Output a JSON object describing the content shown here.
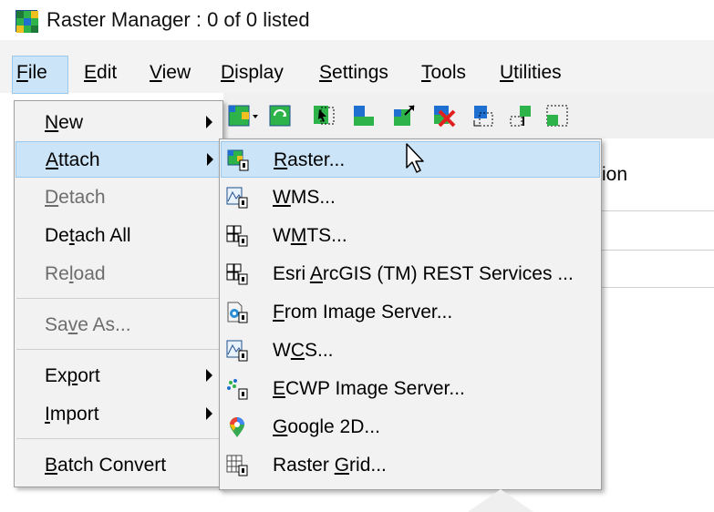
{
  "window": {
    "title": "Raster Manager : 0 of 0 listed"
  },
  "menubar": {
    "items": [
      {
        "label": "File",
        "key": "F",
        "rest": "ile"
      },
      {
        "label": "Edit",
        "key": "E",
        "rest": "dit"
      },
      {
        "label": "View",
        "key": "V",
        "rest": "iew"
      },
      {
        "label": "Display",
        "key": "D",
        "rest": "isplay"
      },
      {
        "label": "Settings",
        "key": "S",
        "rest": "ettings"
      },
      {
        "label": "Tools",
        "key": "T",
        "rest": "ools"
      },
      {
        "label": "Utilities",
        "key": "U",
        "rest": "tilities"
      }
    ]
  },
  "file_menu": {
    "items": [
      {
        "pre": "",
        "key": "N",
        "post": "ew",
        "full": "New",
        "enabled": true,
        "submenu": true
      },
      {
        "pre": "",
        "key": "A",
        "post": "ttach",
        "full": "Attach",
        "enabled": true,
        "submenu": true,
        "highlighted": true
      },
      {
        "pre": "",
        "key": "D",
        "post": "etach",
        "full": "Detach",
        "enabled": false
      },
      {
        "pre": "De",
        "key": "t",
        "post": "ach All",
        "full": "Detach All",
        "enabled": true
      },
      {
        "pre": "Re",
        "key": "l",
        "post": "oad",
        "full": "Reload",
        "enabled": false
      },
      {
        "pre": "Sa",
        "key": "v",
        "post": "e As...",
        "full": "Save As...",
        "enabled": false
      },
      {
        "pre": "Ex",
        "key": "p",
        "post": "ort",
        "full": "Export",
        "enabled": true,
        "submenu": true
      },
      {
        "pre": "",
        "key": "I",
        "post": "mport",
        "full": "Import",
        "enabled": true,
        "submenu": true
      },
      {
        "pre": "",
        "key": "B",
        "post": "atch Convert",
        "full": "Batch Convert",
        "enabled": true
      }
    ]
  },
  "attach_menu": {
    "items": [
      {
        "pre": "",
        "key": "R",
        "post": "aster...",
        "full": "Raster...",
        "icon": "raster-attach-icon",
        "highlighted": true
      },
      {
        "pre": "",
        "key": "W",
        "post": "MS...",
        "full": "WMS...",
        "icon": "wms-icon"
      },
      {
        "pre": "W",
        "key": "M",
        "post": "TS...",
        "full": "WMTS...",
        "icon": "wmts-icon"
      },
      {
        "pre": "Esri ",
        "key": "A",
        "post": "rcGIS (TM) REST Services ...",
        "full": "Esri ArcGIS (TM) REST Services ...",
        "icon": "arcgis-rest-icon"
      },
      {
        "pre": "",
        "key": "F",
        "post": "rom Image Server...",
        "full": "From Image Server...",
        "icon": "image-server-icon"
      },
      {
        "pre": "W",
        "key": "C",
        "post": "S...",
        "full": "WCS...",
        "icon": "wcs-icon"
      },
      {
        "pre": "",
        "key": "E",
        "post": "CWP Image Server...",
        "full": "ECWP Image Server...",
        "icon": "ecwp-icon"
      },
      {
        "pre": "",
        "key": "G",
        "post": "oogle 2D...",
        "full": "Google 2D...",
        "icon": "google-maps-pin-icon"
      },
      {
        "pre": "Raster ",
        "key": "G",
        "post": "rid...",
        "full": "Raster Grid...",
        "icon": "raster-grid-icon"
      }
    ]
  },
  "background": {
    "partial_column_text": "ion"
  },
  "colors": {
    "highlight_bg": "#cce4f7",
    "highlight_border": "#99c9ef",
    "menu_bg": "#f2f2f2",
    "disabled_text": "#6d6d6d"
  }
}
